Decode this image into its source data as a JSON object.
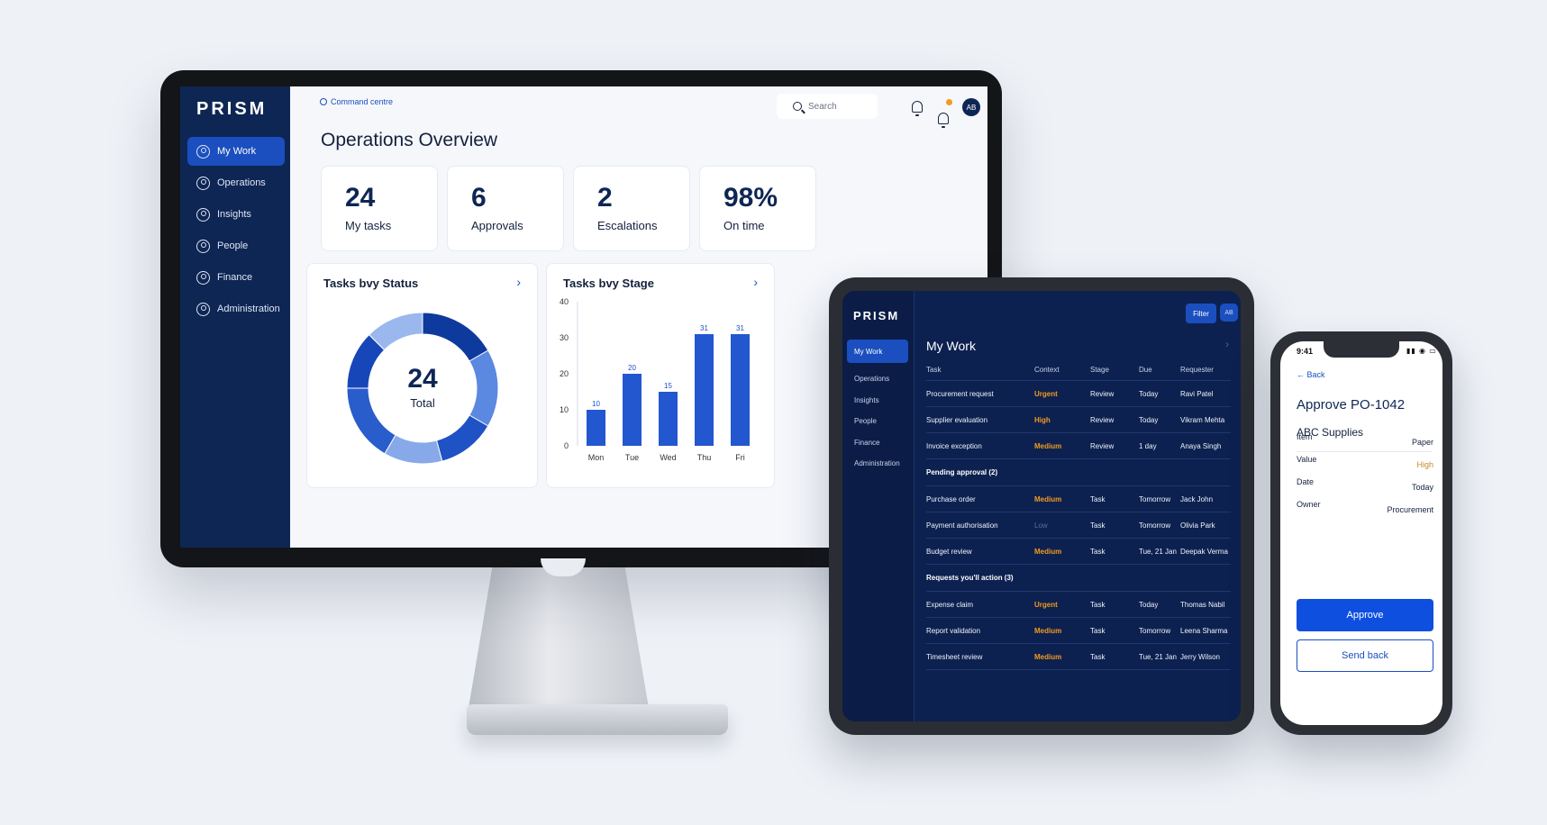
{
  "colors": {
    "navy": "#0e2654",
    "accent_blue": "#1b4fbf",
    "warning_orange": "#f29a1f",
    "background": "#eef1f6"
  },
  "desktop": {
    "logo": "PRISM",
    "nav": [
      {
        "label": "My Work",
        "icon": "briefcase-icon",
        "active": true
      },
      {
        "label": "Operations",
        "icon": "operations-icon",
        "active": false
      },
      {
        "label": "Insights",
        "icon": "insights-icon",
        "active": false
      },
      {
        "label": "People",
        "icon": "people-icon",
        "active": false
      },
      {
        "label": "Finance",
        "icon": "finance-icon",
        "active": false
      },
      {
        "label": "Administration",
        "icon": "administration-icon",
        "active": false
      }
    ],
    "breadcrumb": "Command centre",
    "search_placeholder": "Search",
    "avatar": "AB",
    "page_title": "Operations Overview",
    "kpis": [
      {
        "value": "24",
        "label": "My tasks"
      },
      {
        "value": "6",
        "label": "Approvals"
      },
      {
        "value": "2",
        "label": "Escalations"
      },
      {
        "value": "98%",
        "label": "On time"
      }
    ],
    "status_panel": {
      "title": "Tasks bvy Status",
      "center_value": "24",
      "center_label": "Total"
    },
    "stage_panel": {
      "title": "Tasks bvy Stage"
    }
  },
  "chart_data": [
    {
      "type": "pie",
      "title": "Tasks bvy Status",
      "center_value": "24",
      "center_label": "Total",
      "segments": [
        {
          "value": 4,
          "color": "#0e3a9e"
        },
        {
          "value": 4,
          "color": "#5b88e0"
        },
        {
          "value": 3,
          "color": "#1f52c4"
        },
        {
          "value": 3,
          "color": "#87a9ea"
        },
        {
          "value": 4,
          "color": "#2a5dcc"
        },
        {
          "value": 3,
          "color": "#1746b8"
        },
        {
          "value": 3,
          "color": "#9bb8ee"
        }
      ]
    },
    {
      "type": "bar",
      "title": "Tasks bvy Stage",
      "categories": [
        "Mon",
        "Tue",
        "Wed",
        "Thu",
        "Fri"
      ],
      "values": [
        10,
        20,
        15,
        31,
        31
      ],
      "y_ticks": [
        "0",
        "10",
        "20",
        "30",
        "40"
      ],
      "ylim": [
        0,
        40
      ],
      "bar_color": "#2357cf",
      "grid": false
    }
  ],
  "tablet": {
    "logo": "PRISM",
    "nav": [
      {
        "label": "My Work",
        "active": true
      },
      {
        "label": "Operations",
        "active": false
      },
      {
        "label": "Insights",
        "active": false
      },
      {
        "label": "People",
        "active": false
      },
      {
        "label": "Finance",
        "active": false
      },
      {
        "label": "Administration",
        "active": false
      }
    ],
    "filter_label": "Filter",
    "avatar": "AB",
    "title": "My Work",
    "columns": [
      "Task",
      "Context",
      "Stage",
      "Due",
      "Requester"
    ],
    "rows": [
      {
        "task": "Procurement request",
        "context": "Urgent",
        "level": "urgent",
        "stage": "Review",
        "due": "Today",
        "requester": "Ravi Patel"
      },
      {
        "task": "Supplier evaluation",
        "context": "High",
        "level": "high",
        "stage": "Review",
        "due": "Today",
        "requester": "Vikram Mehta"
      },
      {
        "task": "Invoice exception",
        "context": "Medium",
        "level": "medium",
        "stage": "Review",
        "due": "1 day",
        "requester": "Anaya Singh"
      }
    ],
    "section_pending": "Pending approval  (2)",
    "pending_rows": [
      {
        "task": "Purchase order",
        "context": "Medium",
        "level": "medium",
        "stage": "Task",
        "due": "Tomorrow",
        "requester": "Jack John"
      },
      {
        "task": "Payment authorisation",
        "context": "Low",
        "level": "low",
        "stage": "Task",
        "due": "Tomorrow",
        "requester": "Olivia Park"
      },
      {
        "task": "Budget review",
        "context": "Medium",
        "level": "medium",
        "stage": "Task",
        "due": "Tue, 21 Jan",
        "requester": "Deepak Verma"
      }
    ],
    "section_requests": "Requests you'll action  (3)",
    "request_rows": [
      {
        "task": "Expense claim",
        "context": "Urgent",
        "level": "urgent",
        "stage": "Task",
        "due": "Today",
        "requester": "Thomas Nabil"
      },
      {
        "task": "Report validation",
        "context": "Medium",
        "level": "medium",
        "stage": "Task",
        "due": "Tomorrow",
        "requester": "Leena Sharma"
      },
      {
        "task": "Timesheet review",
        "context": "Medium",
        "level": "medium",
        "stage": "Task",
        "due": "Tue, 21 Jan",
        "requester": "Jerry Wilson"
      }
    ]
  },
  "phone": {
    "time": "9:41",
    "back_label": "Back",
    "title": "Approve PO-1042",
    "subtitle": "ABC Supplies",
    "details": [
      {
        "label": "Item",
        "value": "Paper",
        "highlight": false
      },
      {
        "label": "Value",
        "value": "High",
        "highlight": true
      },
      {
        "label": "Date",
        "value": "Today",
        "highlight": false
      },
      {
        "label": "Owner",
        "value": "Procurement",
        "highlight": false
      }
    ],
    "approve_label": "Approve",
    "send_back_label": "Send back"
  }
}
